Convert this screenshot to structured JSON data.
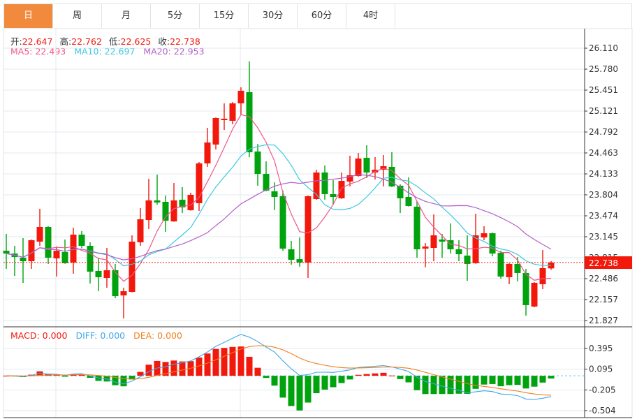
{
  "tabs": [
    {
      "label": "日",
      "active": true
    },
    {
      "label": "周"
    },
    {
      "label": "月"
    },
    {
      "label": "5分"
    },
    {
      "label": "15分"
    },
    {
      "label": "30分"
    },
    {
      "label": "60分"
    },
    {
      "label": "4时"
    }
  ],
  "ohlc_legend": {
    "open_label": "开:",
    "open": "22.647",
    "high_label": "高:",
    "high": "22.762",
    "low_label": "低:",
    "low": "22.625",
    "close_label": "收:",
    "close": "22.738"
  },
  "ma_legend": {
    "ma5_label": "MA5: ",
    "ma5": "22.493",
    "ma10_label": "MA10: ",
    "ma10": "22.697",
    "ma20_label": "MA20: ",
    "ma20": "22.953"
  },
  "macd_legend": {
    "macd": "MACD: 0.000",
    "diff": "DIFF: 0.000",
    "dea": "DEA: 0.000"
  },
  "colors": {
    "up": "#f2180c",
    "down": "#00a30e",
    "ma5": "#f0568a",
    "ma10": "#3ec8e2",
    "ma20": "#b45fc9",
    "diff": "#3fa7ea",
    "dea": "#f07f1f",
    "accent": "#f28a3d",
    "grid": "#e3e9ef"
  },
  "chart_data": [
    {
      "type": "candlestick",
      "y_ticks": [
        "26.110",
        "25.780",
        "25.451",
        "25.121",
        "24.792",
        "24.463",
        "24.133",
        "23.804",
        "23.474",
        "23.145",
        "22.815",
        "22.486",
        "22.157",
        "21.827"
      ],
      "ylim": [
        21.827,
        26.11
      ],
      "last_price_label": "22.738",
      "last_price": 22.738,
      "moving_averages": [
        5,
        10,
        20
      ],
      "candles": [
        [
          22.925,
          23.189,
          22.64,
          22.881
        ],
        [
          22.881,
          23.002,
          22.53,
          22.826
        ],
        [
          22.815,
          23.123,
          22.42,
          22.76
        ],
        [
          22.76,
          23.101,
          22.64,
          23.09
        ],
        [
          23.068,
          23.584,
          23.002,
          23.299
        ],
        [
          23.299,
          23.31,
          22.717,
          22.815
        ],
        [
          22.804,
          22.991,
          22.519,
          22.925
        ],
        [
          22.903,
          23.101,
          22.72,
          22.728
        ],
        [
          22.739,
          23.288,
          22.563,
          23.178
        ],
        [
          23.178,
          23.233,
          22.969,
          23.002
        ],
        [
          23.002,
          23.057,
          22.409,
          22.596
        ],
        [
          22.607,
          22.804,
          22.288,
          22.508
        ],
        [
          22.497,
          22.969,
          22.343,
          22.618
        ],
        [
          22.618,
          22.717,
          22.178,
          22.211
        ],
        [
          22.222,
          22.343,
          21.86,
          22.288
        ],
        [
          22.277,
          23.167,
          22.27,
          23.068
        ],
        [
          23.057,
          23.595,
          23.002,
          23.419
        ],
        [
          23.408,
          24.056,
          23.266,
          23.716
        ],
        [
          23.716,
          24.122,
          23.65,
          23.683
        ],
        [
          23.694,
          23.793,
          23.222,
          23.397
        ],
        [
          23.386,
          23.99,
          23.38,
          23.716
        ],
        [
          23.727,
          23.925,
          23.518,
          23.606
        ],
        [
          23.562,
          23.837,
          23.555,
          23.804
        ],
        [
          23.672,
          24.32,
          23.551,
          24.298
        ],
        [
          24.298,
          24.858,
          24.243,
          24.627
        ],
        [
          24.594,
          25.02,
          24.518,
          25.012
        ],
        [
          24.979,
          25.242,
          24.825,
          25.001
        ],
        [
          24.968,
          25.264,
          24.913,
          25.242
        ],
        [
          25.242,
          25.495,
          25.067,
          25.44
        ],
        [
          25.418,
          25.901,
          24.397,
          24.474
        ],
        [
          24.485,
          24.605,
          23.947,
          24.133
        ],
        [
          24.133,
          24.331,
          23.859,
          23.87
        ],
        [
          23.859,
          24.001,
          23.562,
          23.771
        ],
        [
          23.782,
          23.87,
          22.925,
          22.958
        ],
        [
          22.947,
          23.079,
          22.706,
          22.782
        ],
        [
          22.793,
          23.134,
          22.673,
          22.739
        ],
        [
          22.739,
          23.793,
          22.497,
          23.782
        ],
        [
          23.738,
          24.199,
          23.727,
          24.155
        ],
        [
          24.155,
          24.265,
          23.727,
          23.815
        ],
        [
          23.815,
          24.034,
          23.65,
          23.771
        ],
        [
          23.749,
          24.155,
          23.74,
          24.023
        ],
        [
          24.012,
          24.419,
          23.936,
          24.111
        ],
        [
          24.1,
          24.463,
          24.09,
          24.375
        ],
        [
          24.386,
          24.584,
          24.067,
          24.155
        ],
        [
          24.155,
          24.397,
          24.045,
          24.199
        ],
        [
          24.199,
          24.43,
          23.936,
          24.254
        ],
        [
          24.243,
          24.474,
          23.925,
          23.936
        ],
        [
          23.947,
          23.969,
          23.518,
          23.749
        ],
        [
          23.771,
          24.078,
          23.62,
          23.628
        ],
        [
          23.617,
          23.705,
          22.815,
          22.947
        ],
        [
          22.958,
          23.046,
          22.662,
          22.991
        ],
        [
          22.969,
          23.496,
          22.76,
          23.167
        ],
        [
          23.101,
          23.189,
          22.815,
          23.068
        ],
        [
          23.09,
          23.354,
          22.881,
          22.947
        ],
        [
          22.947,
          23.09,
          22.76,
          22.87
        ],
        [
          22.848,
          23.167,
          22.453,
          22.717
        ],
        [
          22.728,
          23.507,
          22.72,
          23.167
        ],
        [
          23.134,
          23.31,
          23.09,
          23.2
        ],
        [
          23.2,
          23.211,
          22.837,
          22.881
        ],
        [
          22.892,
          22.925,
          22.486,
          22.519
        ],
        [
          22.508,
          22.728,
          22.398,
          22.717
        ],
        [
          22.717,
          22.826,
          22.442,
          22.574
        ],
        [
          22.574,
          22.64,
          21.904,
          22.069
        ],
        [
          22.047,
          22.431,
          22.036,
          22.42
        ],
        [
          22.398,
          22.936,
          22.321,
          22.651
        ],
        [
          22.647,
          22.762,
          22.625,
          22.738
        ]
      ]
    },
    {
      "type": "macd",
      "y_ticks": [
        "0.395",
        "0.095",
        "-0.205",
        "-0.504"
      ],
      "ylim": [
        -0.504,
        0.395
      ]
    }
  ]
}
